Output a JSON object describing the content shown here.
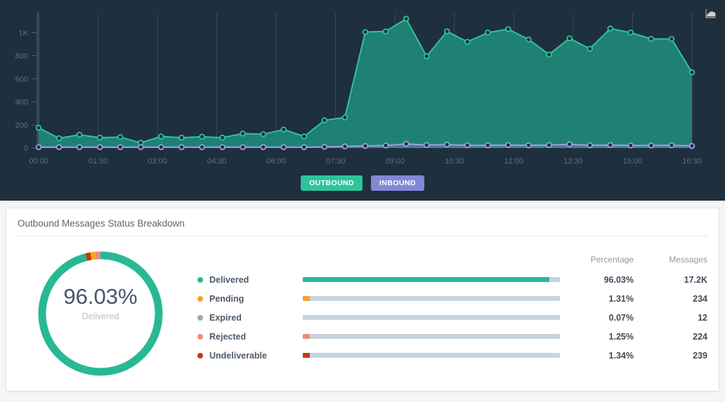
{
  "chart_panel": {
    "toolbar_icon": "area-chart-icon",
    "legend": [
      {
        "label": "OUTBOUND",
        "color": "#2ec49b"
      },
      {
        "label": "INBOUND",
        "color": "#8288d6"
      }
    ],
    "colors": {
      "background": "#1e2f3d",
      "outbound_line": "#2ec49b",
      "outbound_fill": "#1f8676",
      "inbound_line": "#9aa0e0",
      "axis_text": "#5d7184",
      "gridline": "#56626c"
    }
  },
  "chart_data": {
    "type": "area",
    "title": "",
    "xlabel": "",
    "ylabel": "",
    "ylim": [
      0,
      1100
    ],
    "yticks": [
      0,
      200,
      400,
      600,
      800,
      1000
    ],
    "ytick_labels": [
      "0",
      "200",
      "400",
      "600",
      "800",
      "1K"
    ],
    "xtick_labels": [
      "00:00",
      "01:30",
      "03:00",
      "04:30",
      "06:00",
      "07:30",
      "09:00",
      "10:30",
      "12:00",
      "13:30",
      "15:00",
      "16:30"
    ],
    "grid": true,
    "legend_position": "bottom-center",
    "series": [
      {
        "name": "OUTBOUND",
        "color": "#2ec49b",
        "values": [
          175,
          85,
          115,
          90,
          95,
          45,
          100,
          90,
          98,
          90,
          125,
          120,
          160,
          100,
          240,
          265,
          1005,
          1010,
          1120,
          795,
          1010,
          920,
          1000,
          1030,
          940,
          810,
          950,
          860,
          1035,
          1000,
          945,
          945,
          655
        ]
      },
      {
        "name": "INBOUND",
        "color": "#9aa0e0",
        "values": [
          8,
          8,
          8,
          8,
          8,
          8,
          8,
          8,
          8,
          8,
          8,
          8,
          8,
          8,
          10,
          14,
          18,
          22,
          36,
          26,
          30,
          24,
          24,
          26,
          24,
          26,
          32,
          24,
          26,
          22,
          22,
          24,
          18
        ]
      }
    ]
  },
  "card": {
    "title": "Outbound Messages Status Breakdown",
    "donut": {
      "percent": "96.03%",
      "label": "Delivered"
    },
    "table": {
      "headers": {
        "status": "",
        "bar": "",
        "percentage": "Percentage",
        "messages": "Messages"
      },
      "rows": [
        {
          "status": "Delivered",
          "color": "#29b894",
          "percentage": "96.03%",
          "messages": "17.2K",
          "fill_pct": 96.03
        },
        {
          "status": "Pending",
          "color": "#f5a623",
          "percentage": "1.31%",
          "messages": "234",
          "fill_pct": 2.6
        },
        {
          "status": "Expired",
          "color": "#a0a6ab",
          "percentage": "0.07%",
          "messages": "12",
          "fill_pct": 0
        },
        {
          "status": "Rejected",
          "color": "#f08a74",
          "percentage": "1.25%",
          "messages": "224",
          "fill_pct": 2.6
        },
        {
          "status": "Undeliverable",
          "color": "#c4390d",
          "percentage": "1.34%",
          "messages": "239",
          "fill_pct": 2.6
        }
      ]
    },
    "donut_segments": [
      {
        "name": "Delivered",
        "color": "#29b894",
        "value": 96.03
      },
      {
        "name": "Undeliverable",
        "color": "#c4390d",
        "value": 1.34
      },
      {
        "name": "Pending",
        "color": "#f5a623",
        "value": 1.31
      },
      {
        "name": "Rejected",
        "color": "#f08a74",
        "value": 1.25
      },
      {
        "name": "Expired",
        "color": "#a0a6ab",
        "value": 0.07
      }
    ]
  }
}
